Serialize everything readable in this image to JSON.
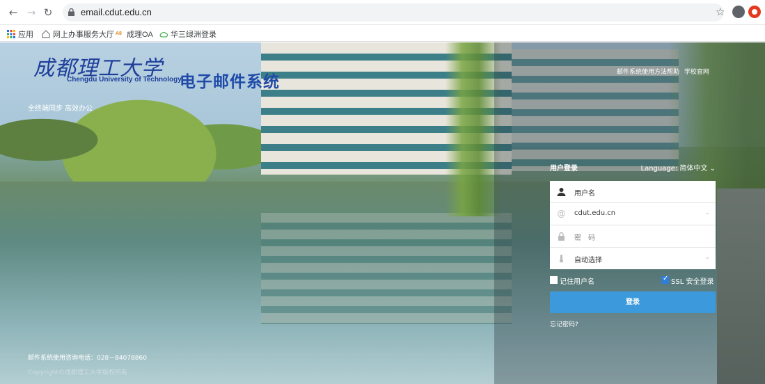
{
  "browser": {
    "url": "email.cdut.edu.cn",
    "bookmarks": [
      {
        "label": "应用",
        "icon": "apps-grid-icon"
      },
      {
        "label": "网上办事服务大厅",
        "icon": "house-icon"
      },
      {
        "label": "成理OA",
        "icon": "oa-icon"
      },
      {
        "label": "华三绿洲登录",
        "icon": "cloud-icon"
      }
    ]
  },
  "header": {
    "school_name": "成都理工大学",
    "school_name_en": "Chengdu University of Technology",
    "system_title": "电子邮件系统",
    "slogan": "全终端同步 高效办公",
    "links": [
      "邮件系统使用方法帮助",
      "学校官网"
    ]
  },
  "login": {
    "tab": "用户登录",
    "language_label": "Language: 简体中文",
    "username_placeholder": "用户名",
    "domain": "cdut.edu.cn",
    "password_placeholder": "密　码",
    "auto_select": "自动选择",
    "remember_label": "记住用户名",
    "ssl_label": "SSL 安全登录",
    "submit": "登录",
    "forgot": "忘记密码?"
  },
  "footer": {
    "phone": "邮件系统使用咨询电话：028－84078860",
    "copyright": "Copyright©成都理工大学版权所有"
  },
  "colors": {
    "brand_blue": "#1f4aa8",
    "login_button": "#3c99dc",
    "checkbox_checked": "#2f7fd8"
  }
}
